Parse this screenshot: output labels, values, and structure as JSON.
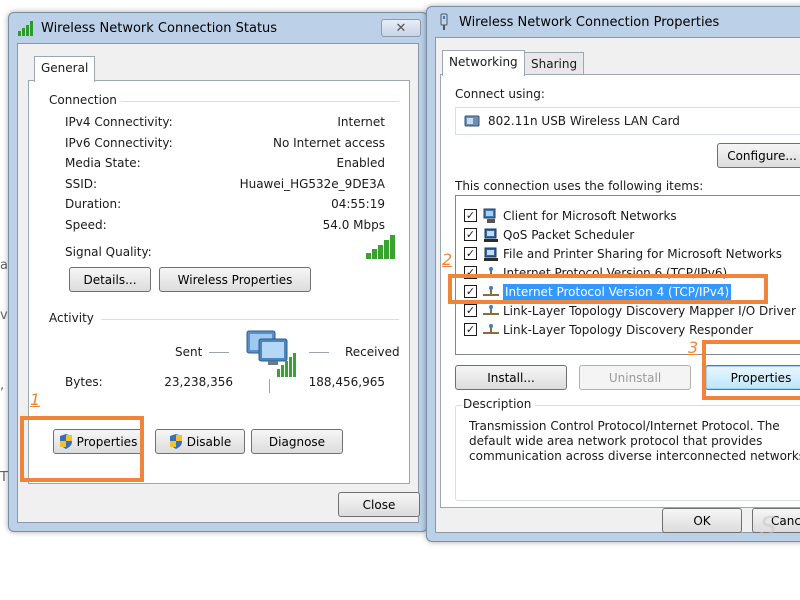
{
  "background": {
    "marks": [
      "a",
      "v",
      ",",
      "T"
    ]
  },
  "status_dialog": {
    "title": "Wireless Network Connection Status",
    "close_glyph": "✕",
    "tab": "General",
    "connection": {
      "label": "Connection",
      "rows": [
        {
          "label": "IPv4 Connectivity:",
          "value": "Internet"
        },
        {
          "label": "IPv6 Connectivity:",
          "value": "No Internet access"
        },
        {
          "label": "Media State:",
          "value": "Enabled"
        },
        {
          "label": "SSID:",
          "value": "Huawei_HG532e_9DE3A"
        },
        {
          "label": "Duration:",
          "value": "04:55:19"
        },
        {
          "label": "Speed:",
          "value": "54.0 Mbps"
        }
      ],
      "signal_label": "Signal Quality:",
      "details_button": "Details...",
      "wireless_properties_button": "Wireless Properties"
    },
    "activity": {
      "label": "Activity",
      "sent_label": "Sent",
      "received_label": "Received",
      "bytes_label": "Bytes:",
      "bytes_sent": "23,238,356",
      "bytes_received": "188,456,965"
    },
    "buttons": {
      "properties": "Properties",
      "disable": "Disable",
      "diagnose": "Diagnose",
      "close": "Close"
    },
    "step_marker": "1"
  },
  "properties_dialog": {
    "title": "Wireless Network Connection Properties",
    "tabs": [
      "Networking",
      "Sharing"
    ],
    "connect_using_label": "Connect using:",
    "adapter_name": "802.11n USB Wireless LAN Card",
    "configure_button": "Configure...",
    "items_label": "This connection uses the following items:",
    "items": [
      {
        "label": "Client for Microsoft Networks",
        "checked": true,
        "icon": "network-client-icon"
      },
      {
        "label": "QoS Packet Scheduler",
        "checked": true,
        "icon": "network-service-icon"
      },
      {
        "label": "File and Printer Sharing for Microsoft Networks",
        "checked": true,
        "icon": "network-service-icon"
      },
      {
        "label": "Internet Protocol Version 6 (TCP/IPv6)",
        "checked": true,
        "icon": "protocol-icon"
      },
      {
        "label": "Internet Protocol Version 4 (TCP/IPv4)",
        "checked": true,
        "icon": "protocol-icon",
        "selected": true
      },
      {
        "label": "Link-Layer Topology Discovery Mapper I/O Driver",
        "checked": true,
        "icon": "protocol-icon"
      },
      {
        "label": "Link-Layer Topology Discovery Responder",
        "checked": true,
        "icon": "protocol-icon"
      }
    ],
    "install_button": "Install...",
    "uninstall_button": "Uninstall",
    "properties_button": "Properties",
    "description_label": "Description",
    "description_text": "Transmission Control Protocol/Internet Protocol. The default wide area network protocol that provides communication across diverse interconnected networks.",
    "ok_button": "OK",
    "cancel_button": "Canc",
    "step_markers": [
      "2",
      "3"
    ]
  },
  "watermark": "S",
  "colors": {
    "highlight": "#f0853a",
    "selection": "#3399ff",
    "frame": "#bcd1e8"
  }
}
